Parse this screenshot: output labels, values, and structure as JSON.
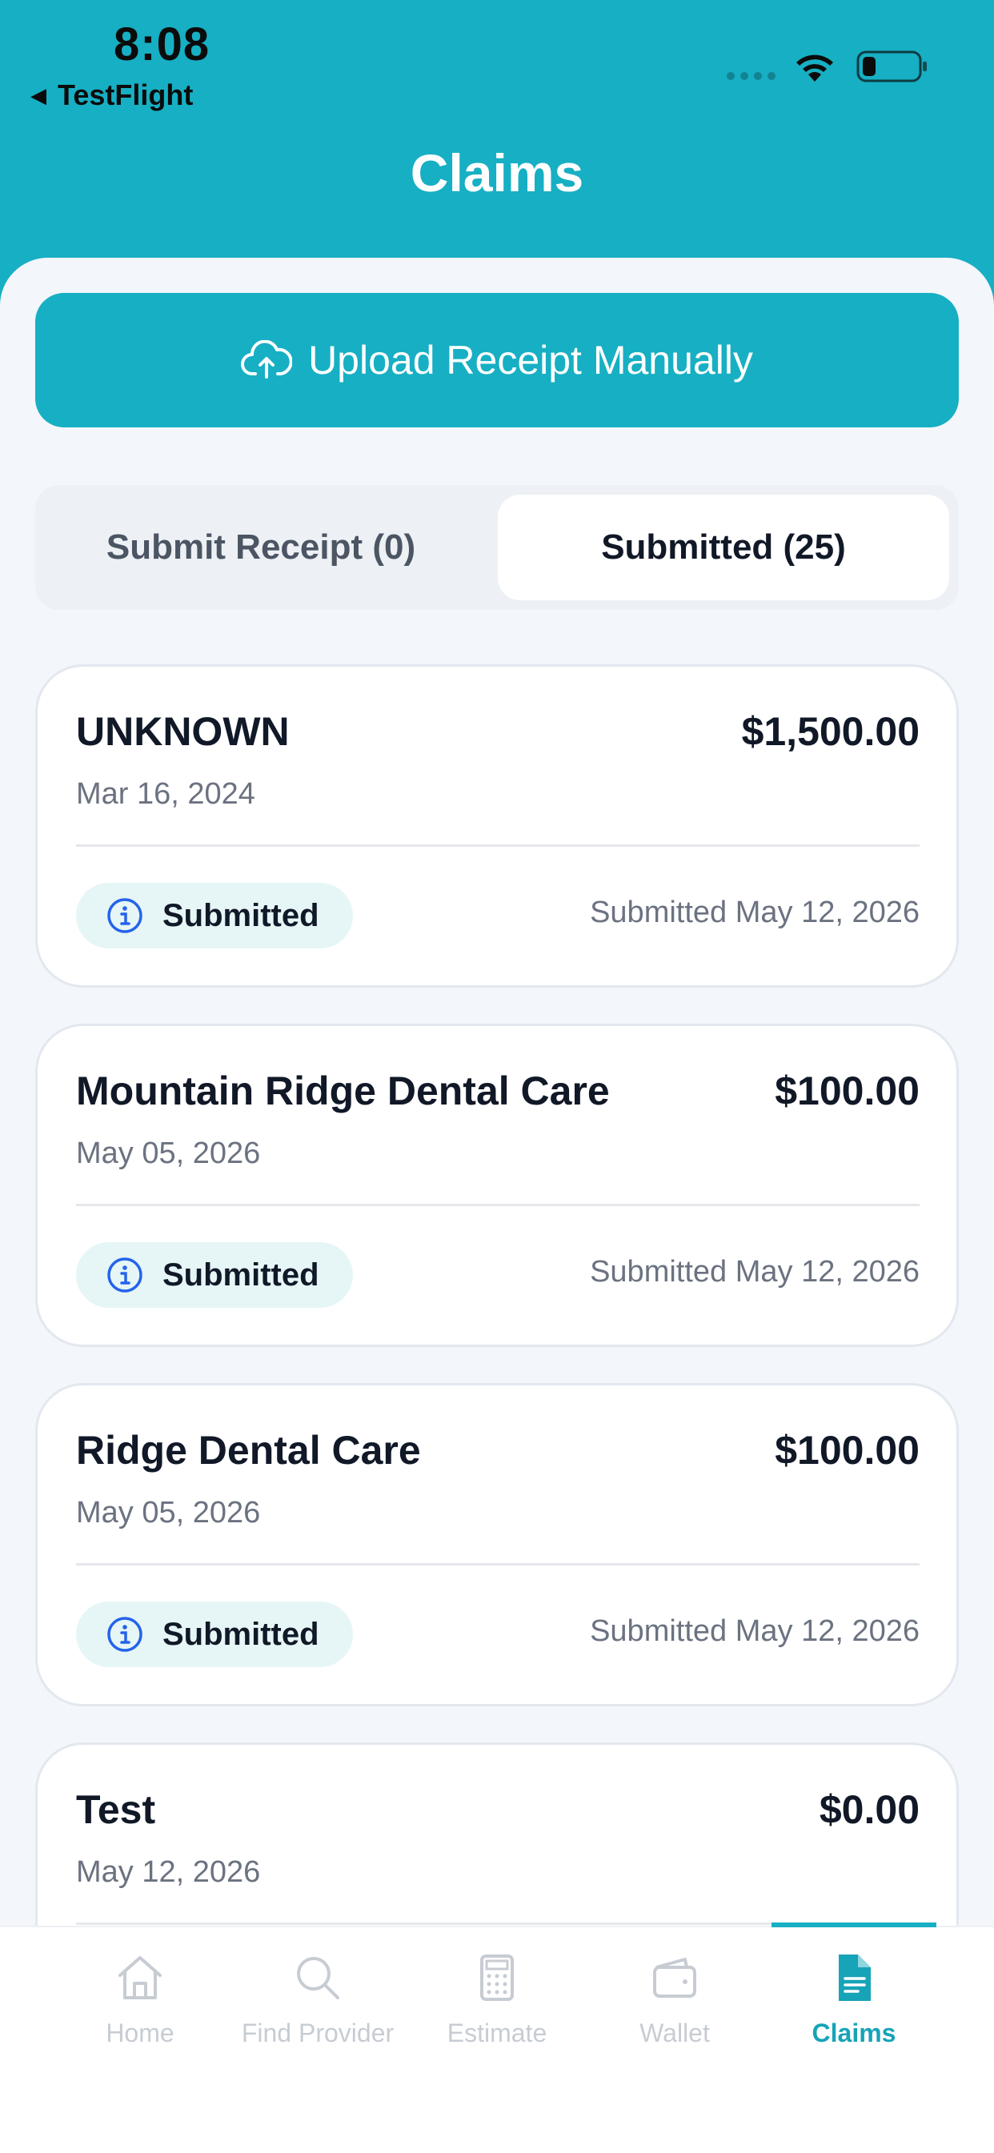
{
  "status_bar": {
    "time": "8:08",
    "back_app": "TestFlight",
    "back_arrow": "◀"
  },
  "header": {
    "title": "Claims"
  },
  "upload_button": {
    "label": "Upload Receipt Manually",
    "icon": "cloud-upload-icon"
  },
  "segments": {
    "submit_receipt": "Submit Receipt (0)",
    "submitted": "Submitted (25)",
    "selected": "submitted"
  },
  "claims": [
    {
      "merchant": "UNKNOWN",
      "amount": "$1,500.00",
      "service_date": "Mar 16, 2024",
      "status": "Submitted",
      "submitted_on": "Submitted May 12, 2026"
    },
    {
      "merchant": "Mountain Ridge Dental Care",
      "amount": "$100.00",
      "service_date": "May 05, 2026",
      "status": "Submitted",
      "submitted_on": "Submitted May 12, 2026"
    },
    {
      "merchant": "Ridge Dental Care",
      "amount": "$100.00",
      "service_date": "May 05, 2026",
      "status": "Submitted",
      "submitted_on": "Submitted May 12, 2026"
    },
    {
      "merchant": "Test",
      "amount": "$0.00",
      "service_date": "May 12, 2026"
    }
  ],
  "tabbar": {
    "home": "Home",
    "find_provider": "Find Provider",
    "estimate": "Estimate",
    "wallet": "Wallet",
    "claims": "Claims",
    "active": "claims"
  },
  "colors": {
    "brand": "#17afc3",
    "badge_bg": "#e6f6f6",
    "info_icon": "#2563eb",
    "inactive_tab": "#c7ccd3"
  }
}
